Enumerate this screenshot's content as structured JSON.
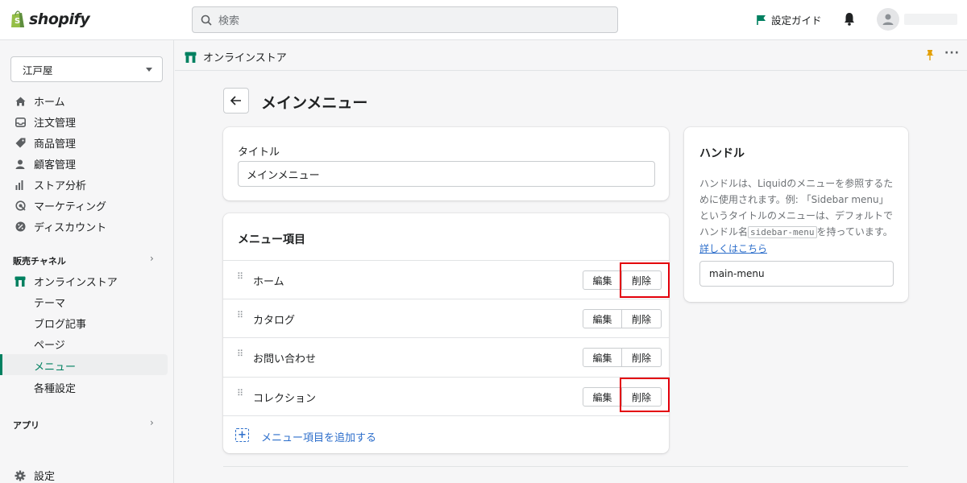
{
  "topbar": {
    "brand": "shopify",
    "search_placeholder": "検索",
    "setup_guide": "設定ガイド"
  },
  "sidebar": {
    "store_name": "江戸屋",
    "items": [
      {
        "label": "ホーム",
        "icon": "home-icon"
      },
      {
        "label": "注文管理",
        "icon": "orders-icon"
      },
      {
        "label": "商品管理",
        "icon": "tag-icon"
      },
      {
        "label": "顧客管理",
        "icon": "customer-icon"
      },
      {
        "label": "ストア分析",
        "icon": "analytics-icon"
      },
      {
        "label": "マーケティング",
        "icon": "marketing-icon"
      },
      {
        "label": "ディスカウント",
        "icon": "discount-icon"
      }
    ],
    "sales_channels_label": "販売チャネル",
    "online_store": "オンラインストア",
    "sub_items": [
      "テーマ",
      "ブログ記事",
      "ページ",
      "メニュー",
      "各種設定"
    ],
    "active_sub": "メニュー",
    "apps_label": "アプリ",
    "settings_label": "設定"
  },
  "breadcrumb": "オンラインストア",
  "page": {
    "title": "メインメニュー"
  },
  "title_card": {
    "label": "タイトル",
    "value": "メインメニュー"
  },
  "menu_card": {
    "heading": "メニュー項目",
    "items": [
      {
        "label": "ホーム",
        "edit": "編集",
        "delete": "削除",
        "highlighted": true
      },
      {
        "label": "カタログ",
        "edit": "編集",
        "delete": "削除",
        "highlighted": false
      },
      {
        "label": "お問い合わせ",
        "edit": "編集",
        "delete": "削除",
        "highlighted": false
      },
      {
        "label": "コレクション",
        "edit": "編集",
        "delete": "削除",
        "highlighted": true
      }
    ],
    "add_label": "メニュー項目を追加する"
  },
  "handle_card": {
    "title": "ハンドル",
    "desc_part1": "ハンドルは、Liquidのメニューを参照するために使用されます。例: 「Sidebar menu」というタイトルのメニューは、デフォルトでハンドル名",
    "desc_code": "sidebar-menu",
    "desc_part2": "を持っています。",
    "learn_more": "詳しくはこちら",
    "value": "main-menu"
  },
  "colors": {
    "accent": "#008060",
    "link": "#2c6ecb",
    "highlight": "#e3000b",
    "pin": "#e3a008"
  }
}
